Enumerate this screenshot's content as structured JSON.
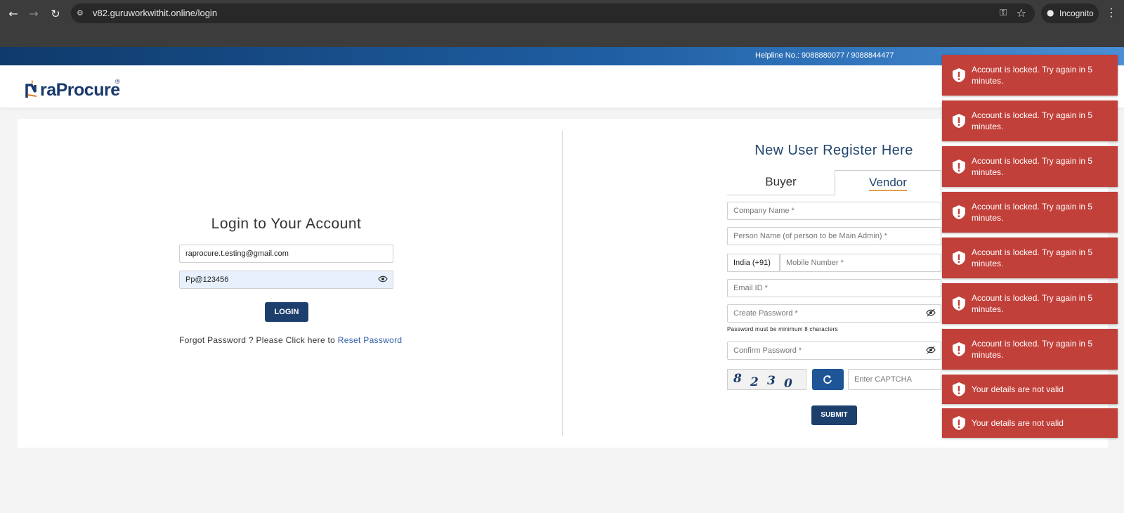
{
  "browser": {
    "url": "v82.guruworkwithit.online/login",
    "profile_label": "Incognito"
  },
  "header": {
    "helpline": "Helpline No.: 9088880077 / 9088844477",
    "logo_text": "raProcure",
    "logo_reg": "®"
  },
  "login": {
    "title": "Login to Your Account",
    "email_value": "raprocure.t.esting@gmail.com",
    "password_value": "Pp@123456",
    "login_button": "LOGIN",
    "forgot_text": "Forgot Password ? Please Click here to ",
    "reset_link": "Reset Password"
  },
  "register": {
    "title": "New User Register Here",
    "tabs": {
      "buyer": "Buyer",
      "vendor": "Vendor"
    },
    "active_tab": "Vendor",
    "company_placeholder": "Company Name *",
    "person_placeholder": "Person Name (of person to be Main Admin) *",
    "country_code": "India (+91)",
    "mobile_placeholder": "Mobile Number *",
    "email_placeholder": "Email ID *",
    "create_password_placeholder": "Create Password *",
    "password_hint": "Password must be minimum 8 characters",
    "confirm_password_placeholder": "Confirm Password *",
    "captcha_digits": [
      "8",
      "2",
      "3",
      "0"
    ],
    "captcha_placeholder": "Enter CAPTCHA",
    "submit_button": "SUBMIT"
  },
  "toasts": [
    {
      "message": "Account is locked. Try again in 5 minutes."
    },
    {
      "message": "Account is locked. Try again in 5 minutes."
    },
    {
      "message": "Account is locked. Try again in 5 minutes."
    },
    {
      "message": "Account is locked. Try again in 5 minutes."
    },
    {
      "message": "Account is locked. Try again in 5 minutes."
    },
    {
      "message": "Account is locked. Try again in 5 minutes."
    },
    {
      "message": "Account is locked. Try again in 5 minutes."
    },
    {
      "message": "Your details are not valid"
    },
    {
      "message": "Your details are not valid"
    }
  ],
  "colors": {
    "toast_bg": "#c2403a",
    "primary_button": "#1d3f6e",
    "link": "#2b5ea7"
  }
}
